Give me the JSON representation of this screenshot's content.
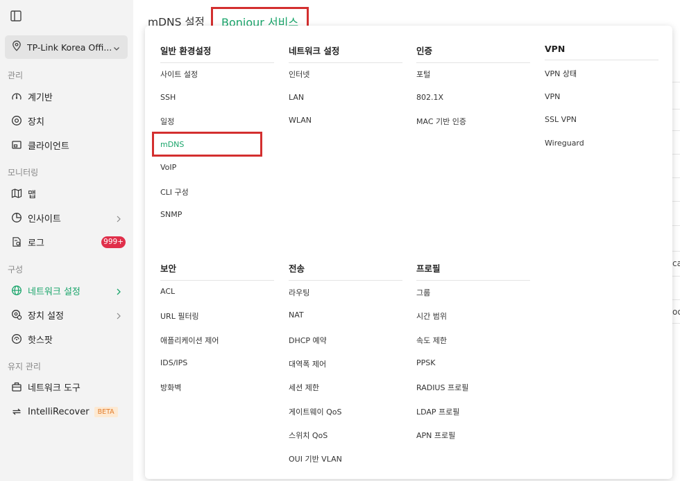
{
  "sidebar": {
    "site_name": "TP-Link Korea Offi...",
    "sections": {
      "manage": "관리",
      "monitoring": "모니터링",
      "config": "구성",
      "maintenance": "유지 관리"
    },
    "items": {
      "dashboard": "계기반",
      "devices": "장치",
      "clients": "클라이언트",
      "map": "맵",
      "insights": "인사이트",
      "logs": "로그",
      "logs_badge": "999+",
      "network_settings": "네트워크 설정",
      "device_settings": "장치 설정",
      "hotspot": "핫스팟",
      "network_tools": "네트워크 도구",
      "intellirecover": "IntelliRecover",
      "beta": "BETA"
    }
  },
  "header": {
    "title": "mDNS 설정",
    "tab": "Bonjour 서비스"
  },
  "background_fragments": [
    "ca",
    "oo"
  ],
  "menu": {
    "general": {
      "title": "일반 환경설정",
      "items": [
        "사이트 설정",
        "SSH",
        "일정",
        "mDNS",
        "VoIP",
        "CLI 구성",
        "SNMP"
      ]
    },
    "network": {
      "title": "네트워크 설정",
      "items": [
        "인터넷",
        "LAN",
        "WLAN"
      ]
    },
    "auth": {
      "title": "인증",
      "items": [
        "포털",
        "802.1X",
        "MAC 기반 인증"
      ]
    },
    "vpn": {
      "title": "VPN",
      "items": [
        "VPN 상태",
        "VPN",
        "SSL VPN",
        "Wireguard"
      ]
    },
    "security": {
      "title": "보안",
      "items": [
        "ACL",
        "URL 필터링",
        "애플리케이션 제어",
        "IDS/IPS",
        "방화벽"
      ]
    },
    "transmission": {
      "title": "전송",
      "items": [
        "라우팅",
        "NAT",
        "DHCP 예약",
        "대역폭 제어",
        "세션 제한",
        "게이트웨이 QoS",
        "스위치 QoS",
        "OUI 기반 VLAN"
      ]
    },
    "profile": {
      "title": "프로필",
      "items": [
        "그룹",
        "시간 범위",
        "속도 제한",
        "PPSK",
        "RADIUS 프로필",
        "LDAP 프로필",
        "APN 프로필"
      ]
    },
    "selected": "mDNS"
  },
  "colors": {
    "accent": "#1aa56b",
    "highlight": "#d32f2f",
    "badge": "#e02f4a"
  }
}
